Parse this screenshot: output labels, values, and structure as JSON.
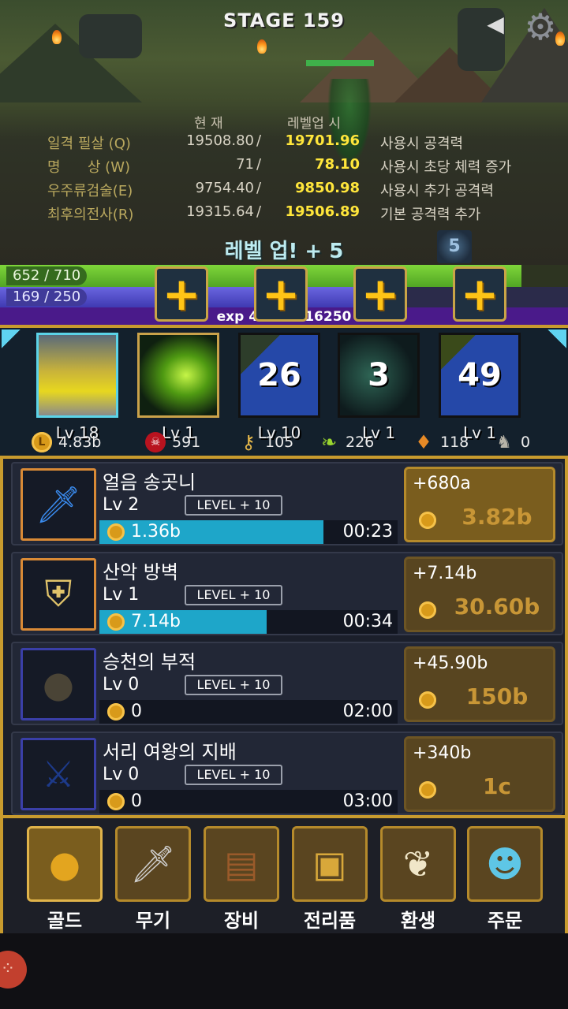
{
  "stage": {
    "title": "STAGE 159"
  },
  "top_controls": {
    "back_icon": "left-triangle-icon",
    "settings_icon": "gear-icon"
  },
  "stats": {
    "header_current": "현 재",
    "header_next": "레벨업 시",
    "rows": [
      {
        "name": "일격 필살 (Q)",
        "current": "19508.80",
        "next": "19701.96",
        "desc": "사용시 공격력"
      },
      {
        "name": "명      상 (W)",
        "current": "71",
        "next": "78.10",
        "desc": "사용시 초당 체력 증가"
      },
      {
        "name": "우주류검술(E)",
        "current": "9754.40",
        "next": "9850.98",
        "desc": "사용시 추가 공격력"
      },
      {
        "name": "최후의전사(R)",
        "current": "19315.64",
        "next": "19506.89",
        "desc": "기본 공격력 추가"
      }
    ],
    "separator": "/",
    "level_up_text": "레벨 업! + 5",
    "buff_badge": "5"
  },
  "bars": {
    "hp_text": "652 / 710",
    "hp_fraction": 0.918,
    "mp_text": "169 / 250",
    "mp_fraction": 0.676,
    "exp_text": "exp 4          16250"
  },
  "plus_buttons": [
    {
      "label": "+"
    },
    {
      "label": "+"
    },
    {
      "label": "+"
    },
    {
      "label": "+"
    }
  ],
  "skills": [
    {
      "id": "hero",
      "level": "Lv 18",
      "cooldown": ""
    },
    {
      "id": "skill1",
      "level": "Lv 1",
      "cooldown": ""
    },
    {
      "id": "skill2",
      "level": "Lv 10",
      "cooldown": "26"
    },
    {
      "id": "skill3",
      "level": "Lv 1",
      "cooldown": "3"
    },
    {
      "id": "skill4",
      "level": "Lv 1",
      "cooldown": "49"
    }
  ],
  "resources": [
    {
      "icon": "gold-coin-icon",
      "value": "4.83b"
    },
    {
      "icon": "skull-icon",
      "value": "591"
    },
    {
      "icon": "key-icon",
      "value": "105"
    },
    {
      "icon": "leaf-icon",
      "value": "226"
    },
    {
      "icon": "crystal-icon",
      "value": "118"
    },
    {
      "icon": "rabbit-icon",
      "value": "0"
    }
  ],
  "items": [
    {
      "name": "얼음 송곳니",
      "level": "Lv 2",
      "level_plus": "LEVEL + 10",
      "progress_value": "1.36b",
      "progress_fraction": 0.75,
      "timer": "00:23",
      "gain": "+680a",
      "cost": "3.82b",
      "owned": true,
      "buy_active": true,
      "icon": "ice-sword-icon"
    },
    {
      "name": "산악 방벽",
      "level": "Lv 1",
      "level_plus": "LEVEL + 10",
      "progress_value": "7.14b",
      "progress_fraction": 0.56,
      "timer": "00:34",
      "gain": "+7.14b",
      "cost": "30.60b",
      "owned": true,
      "buy_active": false,
      "icon": "shield-icon"
    },
    {
      "name": "승천의 부적",
      "level": "Lv 0",
      "level_plus": "LEVEL + 10",
      "progress_value": "0",
      "progress_fraction": 0,
      "timer": "02:00",
      "gain": "+45.90b",
      "cost": "150b",
      "owned": false,
      "buy_active": false,
      "icon": "amulet-icon"
    },
    {
      "name": "서리 여왕의 지배",
      "level": "Lv 0",
      "level_plus": "LEVEL + 10",
      "progress_value": "0",
      "progress_fraction": 0,
      "timer": "03:00",
      "gain": "+340b",
      "cost": "1c",
      "owned": false,
      "buy_active": false,
      "icon": "frost-blade-icon"
    }
  ],
  "menu": [
    {
      "label": "골드",
      "icon": "gold-coin-icon",
      "glyph": "●",
      "selected": true
    },
    {
      "label": "무기",
      "icon": "sword-icon",
      "glyph": "🗡",
      "selected": false
    },
    {
      "label": "장비",
      "icon": "backpack-icon",
      "glyph": "🎒",
      "selected": false
    },
    {
      "label": "전리품",
      "icon": "chest-icon",
      "glyph": "▣",
      "selected": false
    },
    {
      "label": "환생",
      "icon": "winged-amulet-icon",
      "glyph": "❦",
      "selected": false
    },
    {
      "label": "주문",
      "icon": "slime-icon",
      "glyph": "☻",
      "selected": false
    }
  ],
  "colors": {
    "gold_frame": "#c89b2e",
    "hp": "#51a524",
    "mp": "#3f3ab2",
    "exp": "#4a1a8a",
    "progress": "#1ea6c9"
  }
}
